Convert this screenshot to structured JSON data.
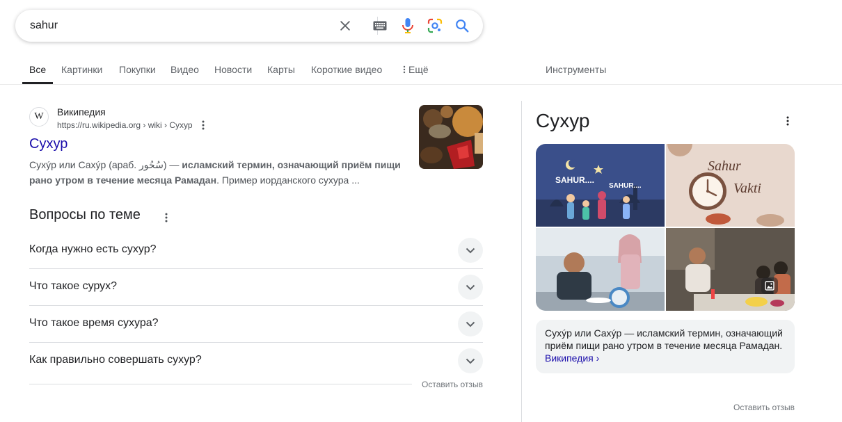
{
  "search": {
    "value": "sahur",
    "icons": [
      "clear-icon",
      "keyboard-icon",
      "microphone-icon",
      "google-lens-icon",
      "search-icon"
    ]
  },
  "tabs": [
    {
      "label": "Все",
      "active": true
    },
    {
      "label": "Картинки"
    },
    {
      "label": "Покупки"
    },
    {
      "label": "Видео"
    },
    {
      "label": "Новости"
    },
    {
      "label": "Карты"
    },
    {
      "label": "Короткие видео"
    },
    {
      "label": "Ещё"
    },
    {
      "label": "Инструменты"
    }
  ],
  "result": {
    "favicon": "W",
    "site_name": "Википедия",
    "url": "https://ru.wikipedia.org › wiki › Сухур",
    "title": "Сухур",
    "snippet_plain1": "Сухýр или Сахýр (араб. سُحُور) — ",
    "snippet_bold1": "исламский термин, означающий приём пищи рано утром в течение месяца Рамадан",
    "snippet_plain2": ". Пример иорданского сухура ..."
  },
  "paa": {
    "title": "Вопросы по теме",
    "questions": [
      "Когда нужно есть сухур?",
      "Что такое сурух?",
      "Что такое время сухура?",
      "Как правильно совершать сухур?"
    ],
    "feedback": "Оставить отзыв"
  },
  "knowledge_panel": {
    "title": "Сухур",
    "images": {
      "img1_text1": "SAHUR....",
      "img1_text2": "SAHUR....",
      "img2_text1": "Sahur",
      "img2_text2": "Vakti"
    },
    "description": "Сухýр или Сахýр — исламский термин, означающий приём пищи рано утром в течение месяца Рамадан. ",
    "link": "Википедия ›",
    "feedback": "Оставить отзыв"
  },
  "colors": {
    "link": "#1a0dab",
    "text": "#202124",
    "muted": "#5f6368",
    "google_blue": "#4285f4",
    "google_red": "#ea4335",
    "google_yellow": "#fbbc04",
    "google_green": "#34a853"
  }
}
